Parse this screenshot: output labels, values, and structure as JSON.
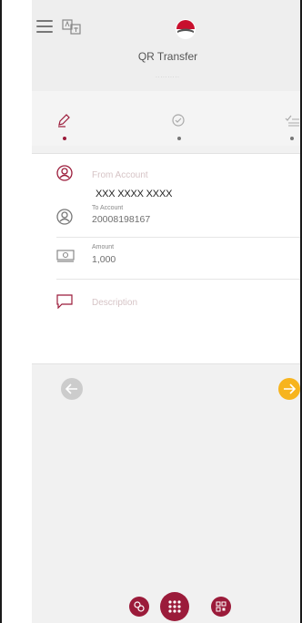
{
  "header": {
    "title": "QR Transfer",
    "subtitle": "··········",
    "icons": [
      "menu-icon",
      "language-icon",
      "logo"
    ]
  },
  "steps": [
    {
      "icon": "pencil-icon",
      "state": "active"
    },
    {
      "icon": "check-circle-icon",
      "state": "inactive"
    },
    {
      "icon": "list-check-icon",
      "state": "inactive"
    }
  ],
  "form": {
    "from_account": {
      "placeholder": "From Account",
      "overlay_value": "XXX XXXX XXXX"
    },
    "to_account": {
      "label": "To Account",
      "value": "20008198167"
    },
    "amount": {
      "label": "Amount",
      "value": "1,000"
    },
    "description": {
      "placeholder": "Description"
    }
  },
  "navigation": {
    "back_icon": "arrow-left-icon",
    "next_icon": "arrow-right-icon"
  },
  "bottom_bar": {
    "icons": [
      "transfers-icon",
      "apps-grid-icon",
      "qr-code-icon"
    ]
  },
  "colors": {
    "primary": "#9b1b3a",
    "accent": "#f7b41e",
    "disabled": "#cccccc"
  }
}
